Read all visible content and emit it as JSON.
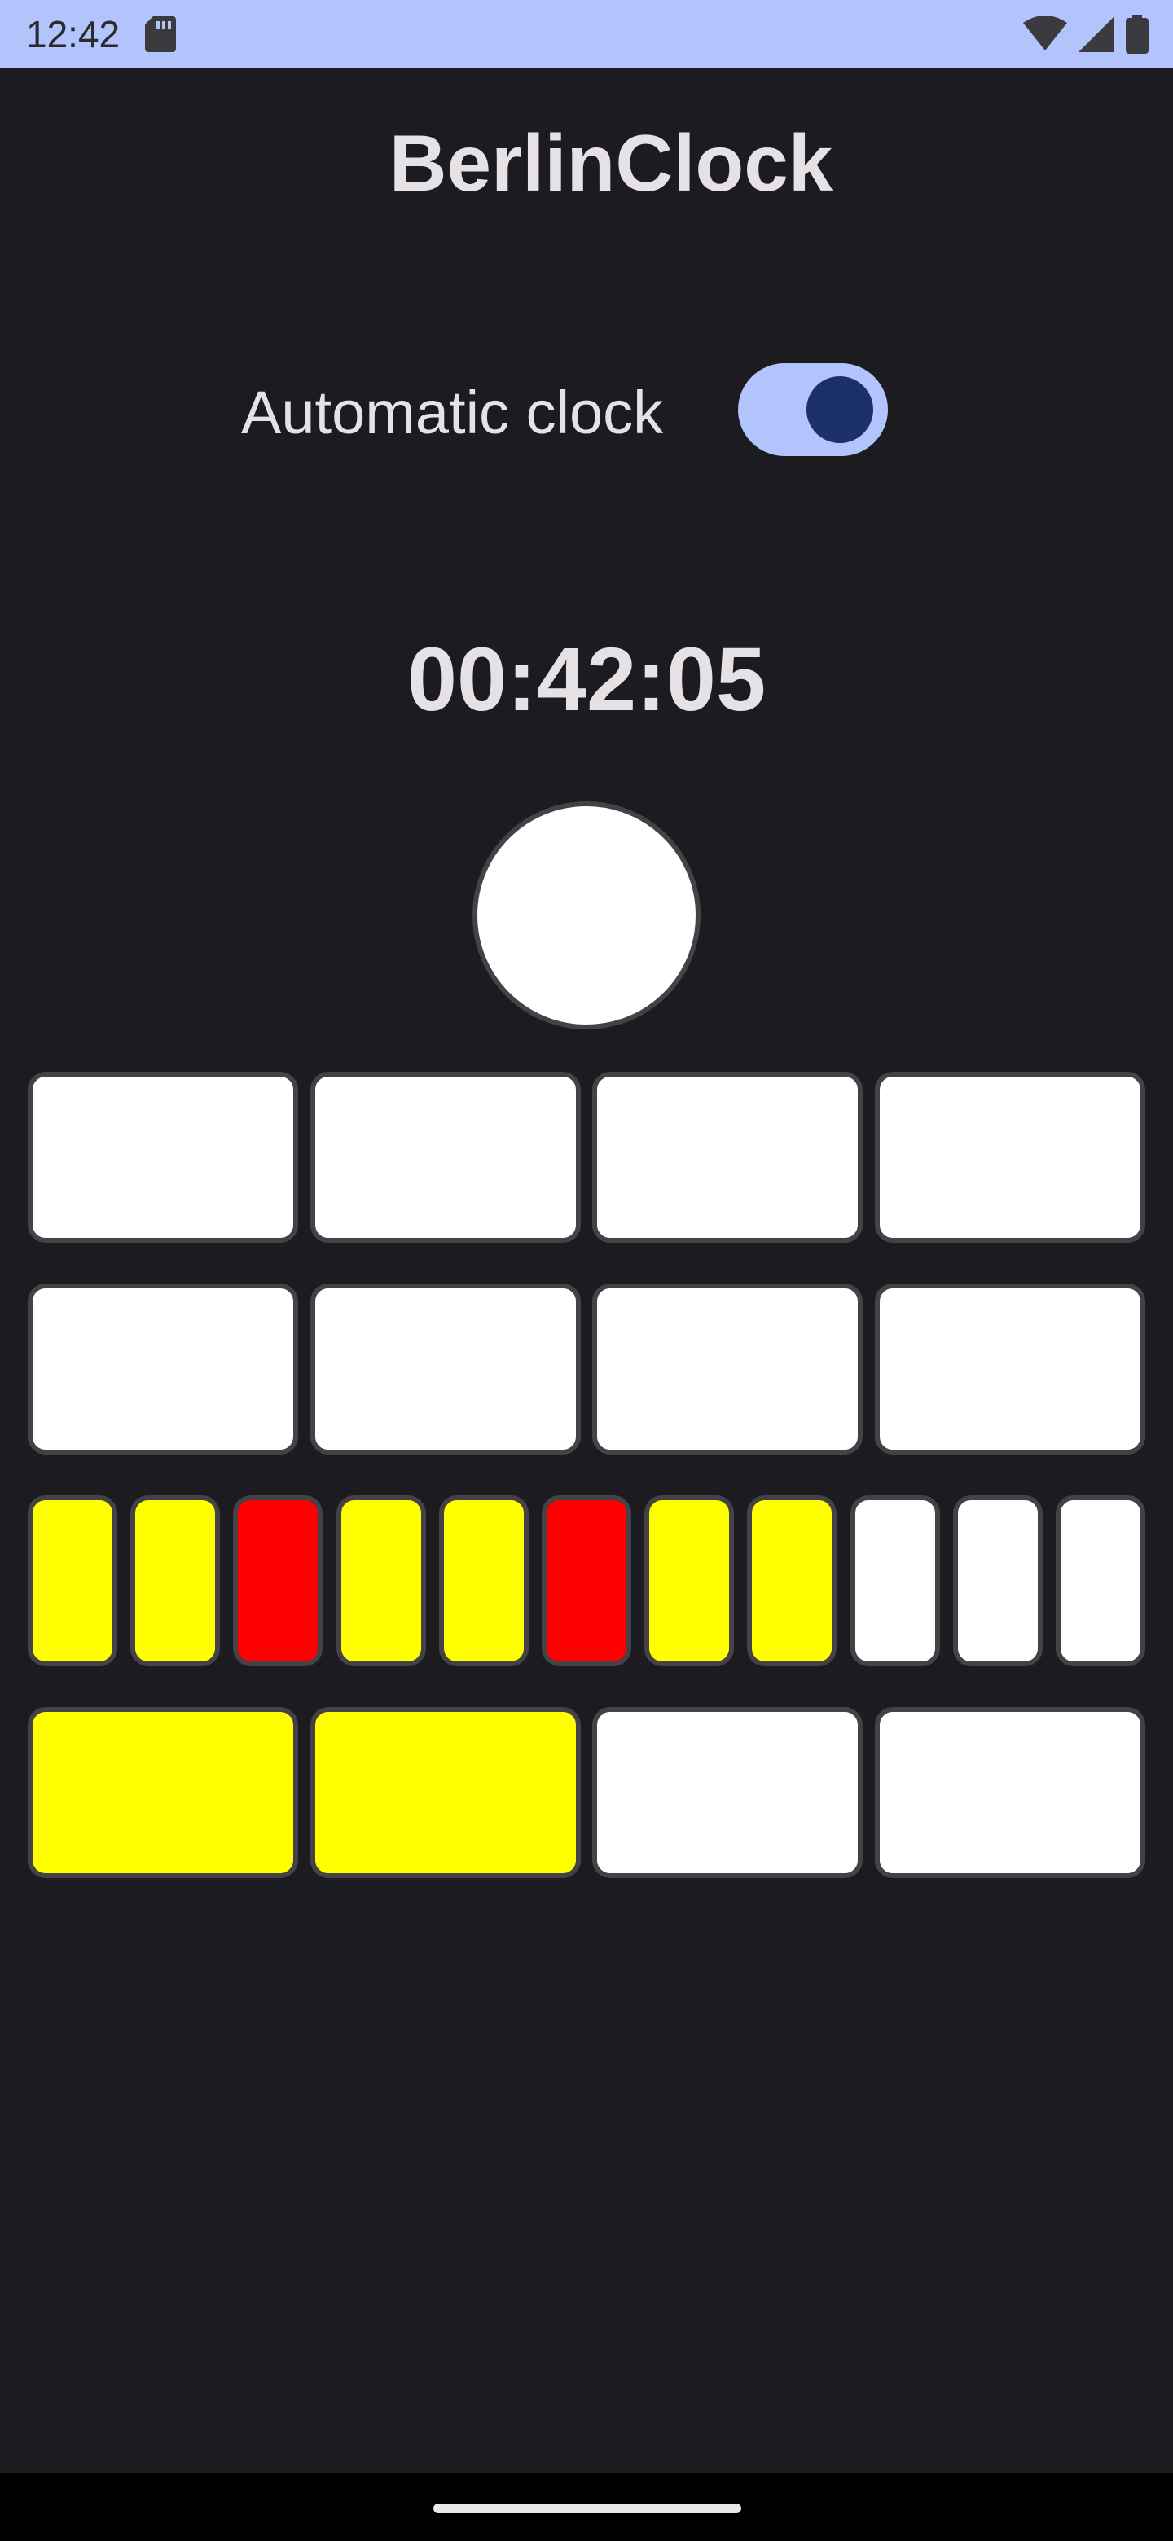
{
  "status_bar": {
    "time": "12:42",
    "icons": [
      "sd-card-icon",
      "wifi-icon",
      "cell-signal-icon",
      "battery-icon"
    ]
  },
  "app": {
    "title": "BerlinClock"
  },
  "automatic_clock": {
    "label": "Automatic clock",
    "enabled": true
  },
  "clock": {
    "digital_time": "00:42:05",
    "seconds_lamp": "white",
    "five_hours_row": [
      "white",
      "white",
      "white",
      "white"
    ],
    "one_hour_row": [
      "white",
      "white",
      "white",
      "white"
    ],
    "five_minutes_row": [
      "yellow",
      "yellow",
      "red",
      "yellow",
      "yellow",
      "red",
      "yellow",
      "yellow",
      "white",
      "white",
      "white"
    ],
    "one_minute_row": [
      "yellow",
      "yellow",
      "white",
      "white"
    ]
  },
  "colors": {
    "background": "#1c1b1f",
    "status_bar": "#b3c3fb",
    "white": "#ffffff",
    "yellow": "#ffff00",
    "red": "#ff0000",
    "lamp_border": "#444246",
    "toggle_track": "#b3c3fb",
    "toggle_knob": "#1b3167"
  }
}
